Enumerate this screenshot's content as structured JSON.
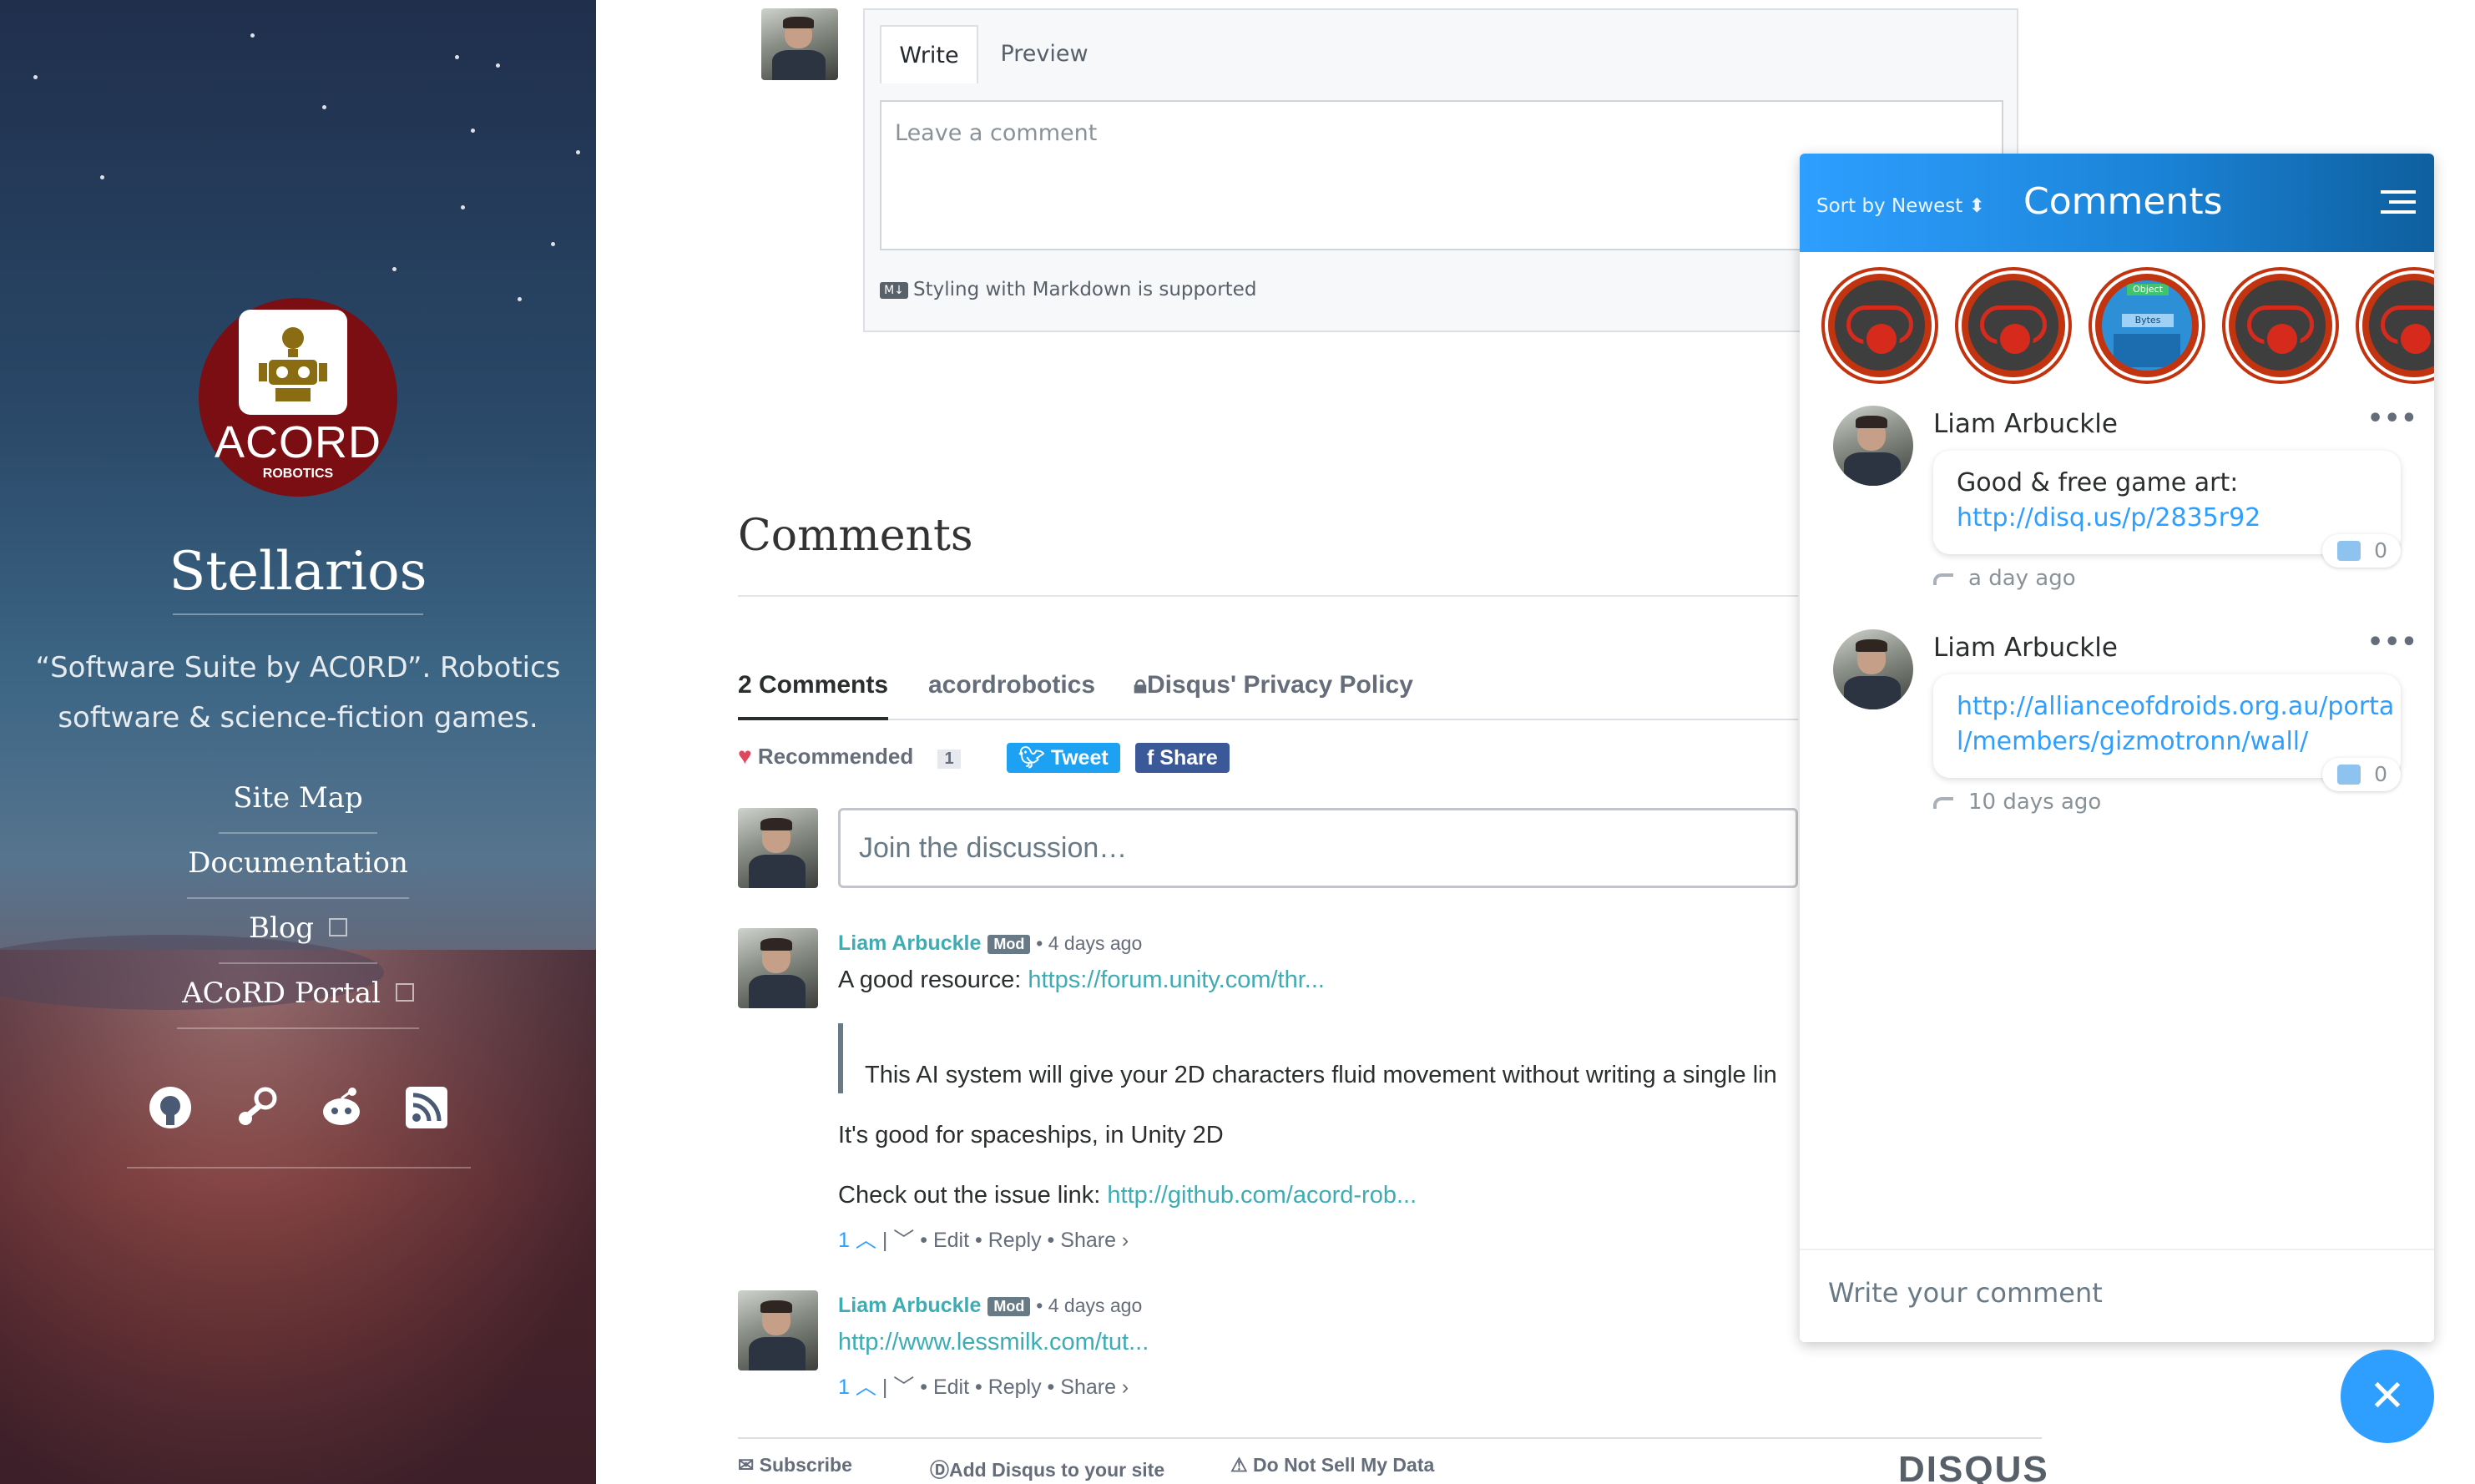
{
  "sidebar": {
    "logo_title": "ACORD",
    "logo_subtitle": "ROBOTICS",
    "site_title": "Stellarios",
    "tagline_line1": "“Software Suite by AC0RD”. Robotics",
    "tagline_line2": "software & science-fiction games.",
    "nav": [
      {
        "label": "Site Map"
      },
      {
        "label": "Documentation"
      },
      {
        "label": "Blog"
      },
      {
        "label": "ACoRD Portal"
      }
    ],
    "social": [
      "github-icon",
      "steam-icon",
      "reddit-icon",
      "rss-icon"
    ]
  },
  "editor": {
    "tab_write": "Write",
    "tab_preview": "Preview",
    "placeholder": "Leave a comment",
    "markdown_badge": "M↓",
    "markdown_note": "Styling with Markdown is supported"
  },
  "comments_section": {
    "heading": "Comments",
    "count_tab": "2 Comments",
    "community_tab": "acordrobotics",
    "privacy_tab": "Disqus' Privacy Policy",
    "recommended_label": "Recommended",
    "recommended_count": "1",
    "tweet_label": "Tweet",
    "share_label": "Share",
    "join_placeholder": "Join the discussion…",
    "posts": [
      {
        "author": "Liam Arbuckle",
        "badge": "Mod",
        "time": "• 4 days ago",
        "line1_prefix": "A good resource: ",
        "line1_link": "https://forum.unity.com/thr...",
        "quote": "This AI system will give your 2D characters fluid movement without writing a single lin",
        "line2": "It's good for spaceships, in Unity 2D",
        "line3_prefix": "Check out the issue link: ",
        "line3_link": "http://github.com/acord-rob...",
        "votes": "1",
        "edit": "Edit",
        "reply": "Reply",
        "share": "Share ›"
      },
      {
        "author": "Liam Arbuckle",
        "badge": "Mod",
        "time": "• 4 days ago",
        "line1_link": "http://www.lessmilk.com/tut...",
        "votes": "1",
        "edit": "Edit",
        "reply": "Reply",
        "share": "Share ›"
      }
    ],
    "footer": {
      "subscribe": "Subscribe",
      "add_disqus": "Add Disqus to your site",
      "do_not_sell": "Do Not Sell My Data",
      "logo": "DISQUS"
    }
  },
  "widget": {
    "sort_prefix": "Sort by ",
    "sort_value": "Newest",
    "title": "Comments",
    "badge_labels": [
      "Object",
      "Bytes"
    ],
    "comments": [
      {
        "author": "Liam Arbuckle",
        "text": "Good & free game art:",
        "link": "http://disq.us/p/2835r92",
        "likes": "0",
        "time": "a day ago"
      },
      {
        "author": "Liam Arbuckle",
        "link_line1": "http://allianceofdroids.org.au/porta",
        "link_line2": "l/members/gizmotronn/wall/",
        "likes": "0",
        "time": "10 days ago"
      }
    ],
    "input_placeholder": "Write your comment"
  },
  "colors": {
    "accent": "#2e9fff",
    "link": "#3eacb3",
    "logo_red": "#7b0e12",
    "badge_red": "#c2330f",
    "tweet": "#1da1f2",
    "facebook": "#3b5998"
  }
}
